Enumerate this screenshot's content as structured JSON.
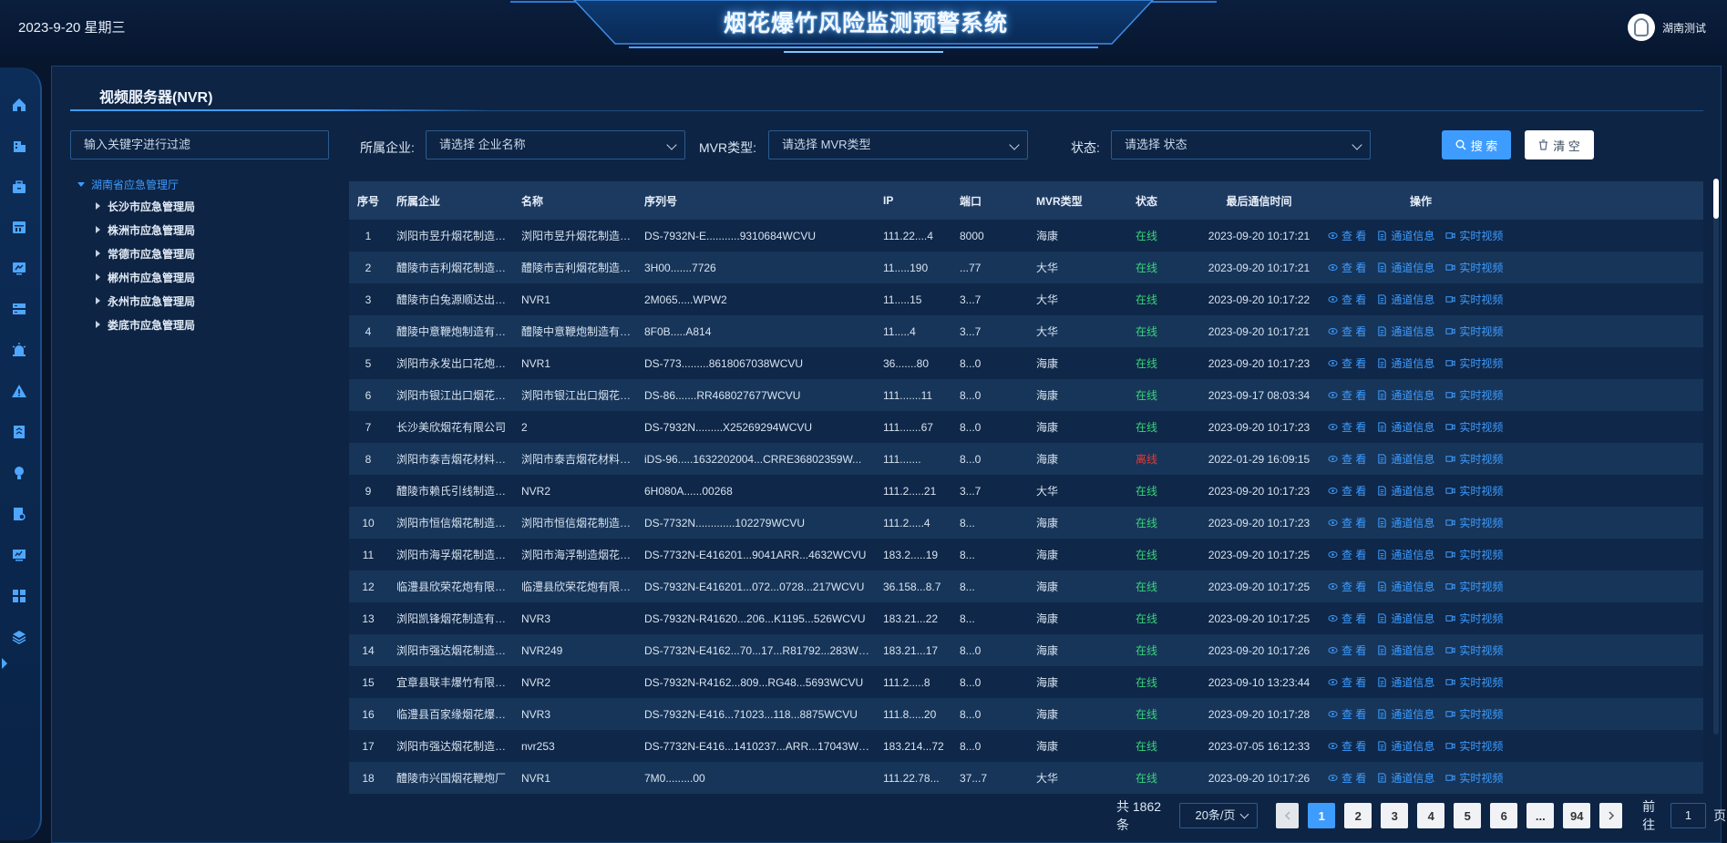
{
  "header": {
    "date": "2023-9-20 星期三",
    "title": "烟花爆竹风险监测预警系统",
    "user_name": "湖南测试"
  },
  "sidebar": {
    "icons": [
      "home-icon",
      "building-icon",
      "briefcase-icon",
      "calendar-icon",
      "monitor-icon",
      "server-icon",
      "alarm-icon",
      "warning-icon",
      "report-icon",
      "bulb-icon",
      "document-search-icon",
      "screen-icon",
      "grid-icon",
      "layers-icon"
    ],
    "active_index": 12
  },
  "page": {
    "title": "视频服务器(NVR)"
  },
  "tree": {
    "search_placeholder": "输入关键字进行过滤",
    "root": "湖南省应急管理厅",
    "children": [
      "长沙市应急管理局",
      "株洲市应急管理局",
      "常德市应急管理局",
      "郴州市应急管理局",
      "永州市应急管理局",
      "娄底市应急管理局"
    ]
  },
  "filters": {
    "company_label": "所属企业:",
    "company_placeholder": "请选择 企业名称",
    "type_label": "MVR类型:",
    "type_placeholder": "请选择 MVR类型",
    "status_label": "状态:",
    "status_placeholder": "请选择 状态",
    "search_label": "搜 索",
    "clear_label": "清 空"
  },
  "table": {
    "headers": [
      "序号",
      "所属企业",
      "名称",
      "序列号",
      "IP",
      "端口",
      "MVR类型",
      "状态",
      "最后通信时间",
      "操作"
    ],
    "op_view": "查 看",
    "op_channel": "通道信息",
    "op_live": "实时视频",
    "rows": [
      {
        "no": "1",
        "company": "浏阳市昱升烟花制造有限...",
        "name": "浏阳市昱升烟花制造有...",
        "serial": "DS-7932N-E...........9310684WCVU",
        "ip": "111.22....4",
        "port": "8000",
        "type": "海康",
        "status": "在线",
        "time": "2023-09-20 10:17:21"
      },
      {
        "no": "2",
        "company": "醴陵市吉利烟花制造有限...",
        "name": "醴陵市吉利烟花制造有...",
        "serial": "3H00.......7726",
        "ip": "11.....190",
        "port": "...77",
        "type": "大华",
        "status": "在线",
        "time": "2023-09-20 10:17:21"
      },
      {
        "no": "3",
        "company": "醴陵市白兔源顺达出口花...",
        "name": "NVR1",
        "serial": "2M065.....WPW2",
        "ip": "11.....15",
        "port": "3...7",
        "type": "大华",
        "status": "在线",
        "time": "2023-09-20 10:17:22"
      },
      {
        "no": "4",
        "company": "醴陵中意鞭炮制造有限公司",
        "name": "醴陵中意鞭炮制造有限...",
        "serial": "8F0B.....A814",
        "ip": "11.....4",
        "port": "3...7",
        "type": "大华",
        "status": "在线",
        "time": "2023-09-20 10:17:21"
      },
      {
        "no": "5",
        "company": "浏阳市永发出口花炮厂（...",
        "name": "NVR1",
        "serial": "DS-773.........8618067038WCVU",
        "ip": "36.......80",
        "port": "8...0",
        "type": "海康",
        "status": "在线",
        "time": "2023-09-20 10:17:23"
      },
      {
        "no": "6",
        "company": "浏阳市银江出口烟花制造...",
        "name": "浏阳市银江出口烟花制...",
        "serial": "DS-86.......RR468027677WCVU",
        "ip": "111.......11",
        "port": "8...0",
        "type": "海康",
        "status": "在线",
        "time": "2023-09-17 08:03:34"
      },
      {
        "no": "7",
        "company": "长沙美欣烟花有限公司",
        "name": "2",
        "serial": "DS-7932N.........X25269294WCVU",
        "ip": "111.......67",
        "port": "8...0",
        "type": "海康",
        "status": "在线",
        "time": "2023-09-20 10:17:23"
      },
      {
        "no": "8",
        "company": "浏阳市泰吉烟花材料制造...",
        "name": "浏阳市泰吉烟花材料制...",
        "serial": "iDS-96.....1632202004...CRRE36802359W...",
        "ip": "111.......",
        "port": "8...0",
        "type": "海康",
        "status": "离线",
        "time": "2022-01-29 16:09:15"
      },
      {
        "no": "9",
        "company": "醴陵市赖氏引线制造有限...",
        "name": "NVR2",
        "serial": "6H080A......00268",
        "ip": "111.2.....21",
        "port": "3...7",
        "type": "大华",
        "status": "在线",
        "time": "2023-09-20 10:17:23"
      },
      {
        "no": "10",
        "company": "浏阳市恒信烟花制造有限...",
        "name": "浏阳市恒信烟花制造有...",
        "serial": "DS-7732N.............102279WCVU",
        "ip": "111.2.....4",
        "port": "8...",
        "type": "海康",
        "status": "在线",
        "time": "2023-09-20 10:17:23"
      },
      {
        "no": "11",
        "company": "浏阳市海孚烟花制造有限...",
        "name": "浏阳市海浮制造烟花有...",
        "serial": "DS-7732N-E416201...9041ARR...4632WCVU",
        "ip": "183.2.....19",
        "port": "8...",
        "type": "海康",
        "status": "在线",
        "time": "2023-09-20 10:17:25"
      },
      {
        "no": "12",
        "company": "临澧县欣荣花炮有限责任...",
        "name": "临澧县欣荣花炮有限责...",
        "serial": "DS-7932N-E416201...072...0728...217WCVU",
        "ip": "36.158...8.7",
        "port": "8...",
        "type": "海康",
        "status": "在线",
        "time": "2023-09-20 10:17:25"
      },
      {
        "no": "13",
        "company": "浏阳凯锋烟花制造有限公司",
        "name": "NVR3",
        "serial": "DS-7932N-R41620...206...K1195...526WCVU",
        "ip": "183.21...22",
        "port": "8...",
        "type": "海康",
        "status": "在线",
        "time": "2023-09-20 10:17:25"
      },
      {
        "no": "14",
        "company": "浏阳市强达烟花制造有限...",
        "name": "NVR249",
        "serial": "DS-7732N-E4162...70...17...R81792...283WCVU",
        "ip": "183.21...17",
        "port": "8...0",
        "type": "海康",
        "status": "在线",
        "time": "2023-09-20 10:17:26"
      },
      {
        "no": "15",
        "company": "宜章县联丰爆竹有限公司",
        "name": "NVR2",
        "serial": "DS-7932N-R4162...809...RG48...5693WCVU",
        "ip": "111.2.....8",
        "port": "8...0",
        "type": "海康",
        "status": "在线",
        "time": "2023-09-10 13:23:44"
      },
      {
        "no": "16",
        "company": "临澧县百家缘烟花爆竹产...",
        "name": "NVR3",
        "serial": "DS-7932N-E416...71023...118...8875WCVU",
        "ip": "111.8.....20",
        "port": "8...0",
        "type": "海康",
        "status": "在线",
        "time": "2023-09-20 10:17:28"
      },
      {
        "no": "17",
        "company": "浏阳市强达烟花制造有限...",
        "name": "nvr253",
        "serial": "DS-7732N-E416...1410237...ARR...17043WCVU",
        "ip": "183.214...72",
        "port": "8...0",
        "type": "海康",
        "status": "在线",
        "time": "2023-07-05 16:12:33"
      },
      {
        "no": "18",
        "company": "醴陵市兴国烟花鞭炮厂",
        "name": "NVR1",
        "serial": "7M0.........00",
        "ip": "111.22.78...",
        "port": "37...7",
        "type": "大华",
        "status": "在线",
        "time": "2023-09-20 10:17:26"
      }
    ]
  },
  "pagination": {
    "total_text": "共 1862 条",
    "page_size": "20条/页",
    "pages": [
      "1",
      "2",
      "3",
      "4",
      "5",
      "6",
      "...",
      "94"
    ],
    "current_page": "1",
    "goto_prefix": "前往",
    "goto_value": "1",
    "goto_suffix": "页"
  },
  "colors": {
    "accent": "#3e9cff",
    "online": "#37d67a",
    "offline": "#e53935"
  }
}
